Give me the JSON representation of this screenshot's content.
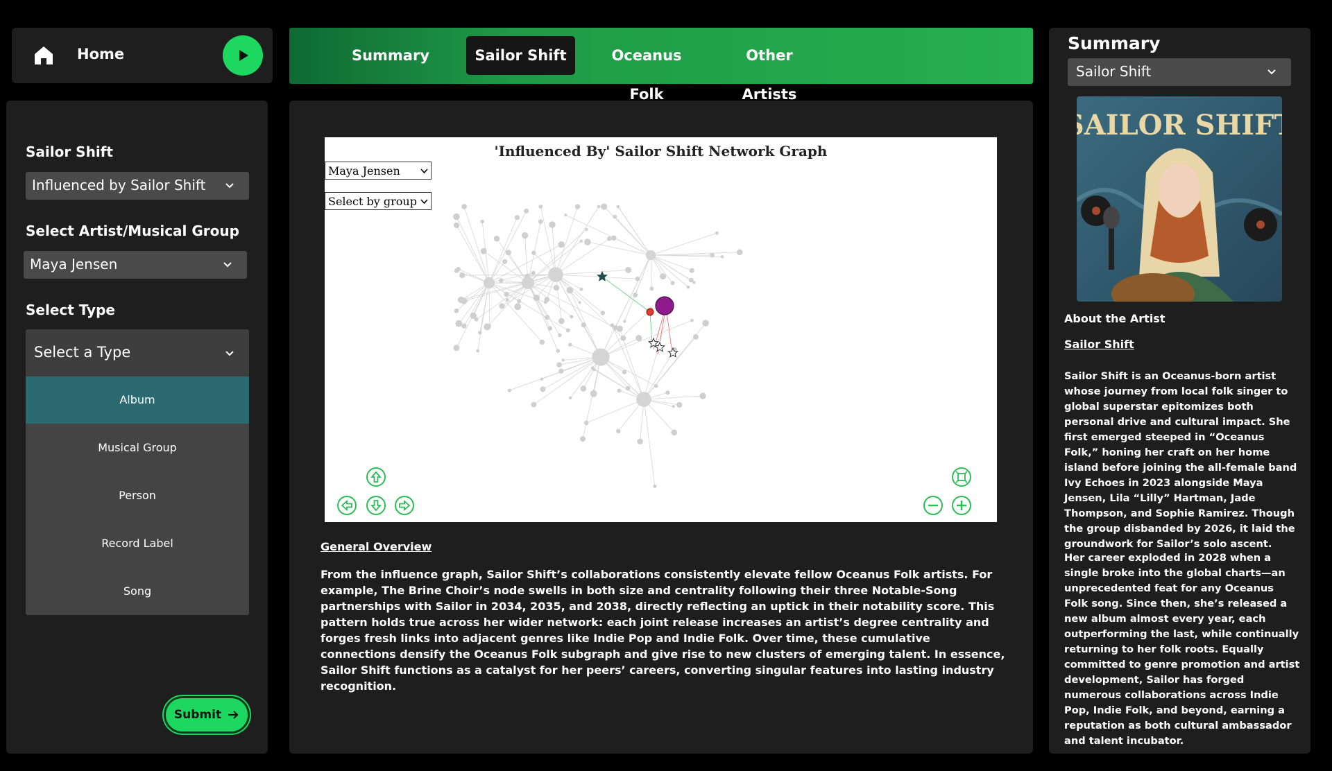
{
  "home": {
    "label": "Home"
  },
  "nav": {
    "tabs": [
      "Summary",
      "Sailor Shift",
      "Oceanus Folk",
      "Other Artists"
    ],
    "active": "Sailor Shift"
  },
  "left": {
    "section1_label": "Sailor Shift",
    "mode_value": "Influenced by Sailor Shift",
    "section2_label": "Select Artist/Musical Group",
    "artist_value": "Maya Jensen",
    "section3_label": "Select Type",
    "type_placeholder": "Select a Type",
    "type_options": [
      "Album",
      "Musical Group",
      "Person",
      "Record Label",
      "Song"
    ],
    "selected_type": "Album",
    "submit_label": "Submit"
  },
  "graph": {
    "title": "'Influenced By' Sailor Shift Network Graph",
    "node_select_value": "Maya Jensen",
    "group_select_value": "Select by group"
  },
  "overview": {
    "title": "General Overview",
    "body": "From the influence graph, Sailor Shift’s collaborations consistently elevate fellow Oceanus Folk artists. For example, The Brine Choir’s node swells in both size and centrality following their three Notable-Song partnerships with Sailor in 2034, 2035, and 2038, directly reflecting an uptick in their notability score. This pattern holds true across her wider network: each joint release increases an artist’s degree centrality and forges fresh links into adjacent genres like Indie Pop and Indie Folk. Over time, these cumulative connections densify the Oceanus Folk subgraph and give rise to new clusters of emerging talent. In essence, Sailor Shift functions as a catalyst for her peers’ careers, converting singular features into lasting industry recognition."
  },
  "right": {
    "title": "Summary",
    "artist_select_value": "Sailor Shift",
    "album_art_text": "SAILOR SHIFT",
    "about_title": "About the Artist",
    "artist_name": "Sailor Shift",
    "bio_1": "Sailor Shift is an Oceanus-born artist whose journey from local folk singer to global superstar epitomizes both personal drive and cultural impact. She first emerged steeped in “Oceanus Folk,” honing her craft on her home island before joining the all-female band Ivy Echoes in 2023 alongside Maya Jensen, Lila “Lilly” Hartman, Jade Thompson, and Sophie Ramirez. Though the group disbanded by 2026, it laid the groundwork for Sailor’s solo ascent.",
    "bio_2": "Her career exploded in 2028 when a single broke into the global charts—an unprecedented feat for any Oceanus Folk song. Since then, she’s released a new album almost every year, each outperforming the last, while continually returning to her folk roots. Equally committed to genre promotion and artist development, Sailor has forged numerous collaborations across Indie Pop, Indie Folk, and beyond, earning a reputation as both cultural ambassador and talent incubator."
  },
  "colors": {
    "accent_green": "#1ed760",
    "selected_option": "#2c6a72",
    "node_highlight": "#8e1a8c",
    "node_red": "#e03a2f",
    "node_teal": "#1f4e4a"
  }
}
